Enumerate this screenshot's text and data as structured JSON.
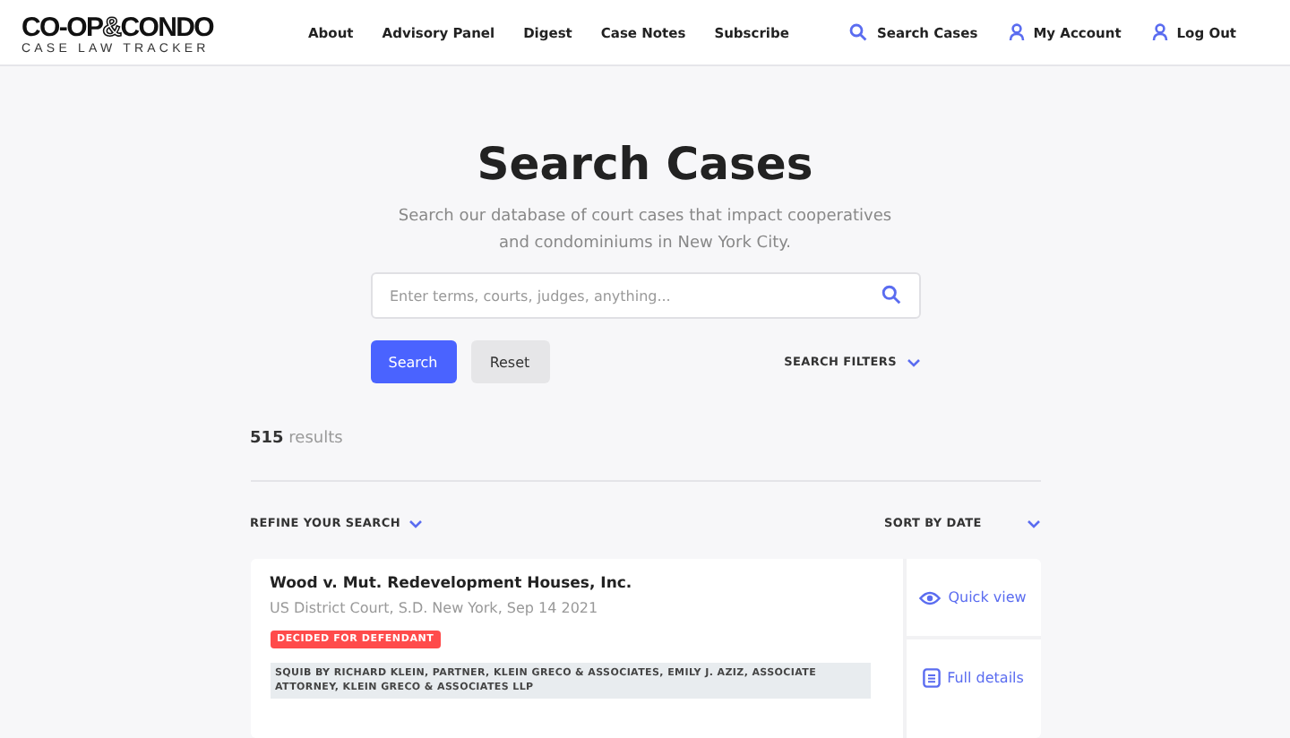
{
  "logo": {
    "wordmark_left": "CO-OP",
    "ampersand": "&",
    "wordmark_right": "CONDO",
    "tagline": "CASE LAW TRACKER"
  },
  "nav": [
    "About",
    "Advisory Panel",
    "Digest",
    "Case Notes",
    "Subscribe"
  ],
  "account_links": [
    {
      "label": "Search Cases",
      "kind": "search"
    },
    {
      "label": "My Account",
      "kind": "user"
    },
    {
      "label": "Log Out",
      "kind": "user"
    }
  ],
  "hero": {
    "title": "Search Cases",
    "subtitle": "Search our database of court cases that impact cooperatives and condominiums in New York City."
  },
  "search": {
    "placeholder": "Enter terms, courts, judges, anything..."
  },
  "buttons": {
    "search": "Search",
    "reset": "Reset",
    "filters": "SEARCH FILTERS"
  },
  "results_count": "**515** results",
  "refine": "REFINE YOUR SEARCH",
  "sort": "SORT BY DATE",
  "cases": [
    {
      "title": "Wood v. Mut. Redevelopment Houses, Inc.",
      "court": "US District Court, S.D. New York, Sep 14 2021",
      "decision": "DECIDED FOR DEFENDANT",
      "squib": "SQUIB BY RICHARD KLEIN, PARTNER, KLEIN GRECO & ASSOCIATES, EMILY J. AZIZ, ASSOCIATE ATTORNEY, KLEIN GRECO & ASSOCIATES LLP",
      "actions": [
        {
          "label": "Quick view",
          "kind": "eye"
        },
        {
          "label": "Full details",
          "kind": "doc"
        }
      ]
    }
  ]
}
